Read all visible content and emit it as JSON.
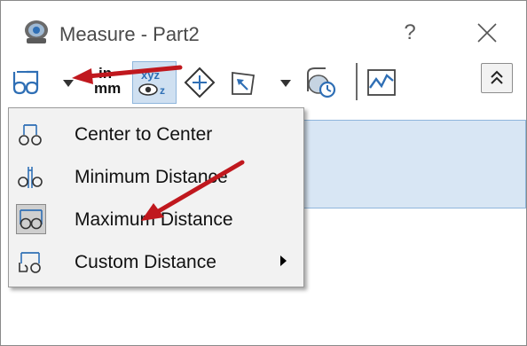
{
  "window": {
    "title": "Measure - Part2",
    "help_label": "?",
    "icon": "measure-app-icon"
  },
  "toolbar": {
    "units_top": "in",
    "units_bottom": "mm",
    "buttons": [
      "arc-condition-icon",
      "dropdown-arrow-icon",
      "units-precision-icon",
      "show-xyz-icon",
      "point-to-point-icon",
      "projection-icon",
      "projection-dropdown-icon",
      "history-icon",
      "sensor-graph-icon",
      "collapse-chevron-icon"
    ]
  },
  "menu": {
    "items": [
      {
        "label": "Center to Center",
        "icon": "center-to-center-icon",
        "checked": false,
        "has_submenu": false
      },
      {
        "label": "Minimum Distance",
        "icon": "minimum-distance-icon",
        "checked": false,
        "has_submenu": false
      },
      {
        "label": "Maximum Distance",
        "icon": "maximum-distance-icon",
        "checked": true,
        "has_submenu": false
      },
      {
        "label": "Custom Distance",
        "icon": "custom-distance-icon",
        "checked": false,
        "has_submenu": true
      }
    ]
  },
  "colors": {
    "annotation_arrow": "#c0181e",
    "icon_blue": "#2f6fb5",
    "selection": "#d8e6f4"
  }
}
